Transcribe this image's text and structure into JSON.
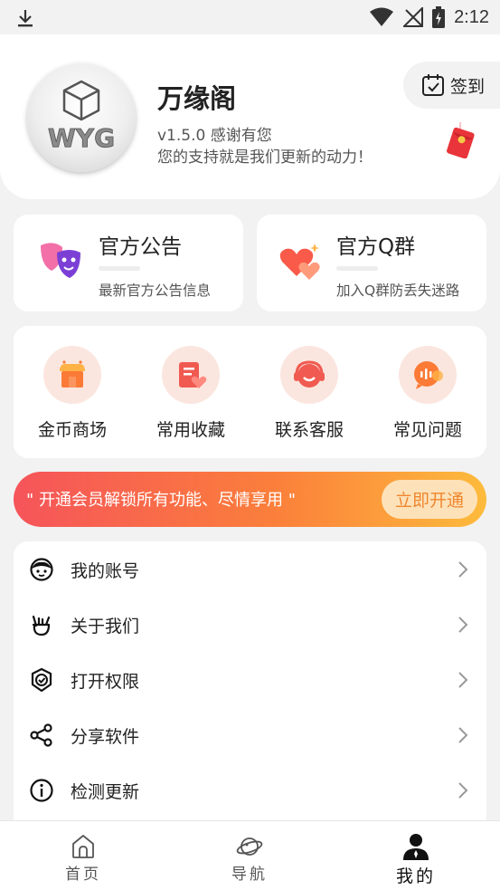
{
  "status_bar": {
    "time": "2:12",
    "icons": [
      "download-icon",
      "wifi-icon",
      "no-signal-icon",
      "battery-charging-icon"
    ]
  },
  "profile": {
    "app_name": "万缘阁",
    "logo_text": "WYG",
    "version_line": "v1.5.0  感谢有您",
    "slogan": "您的支持就是我们更新的动力！",
    "signin_label": "签到",
    "signin_icon": "calendar-check-icon"
  },
  "info_cards": [
    {
      "title": "官方公告",
      "subtitle": "最新官方公告信息",
      "icon": "masks-icon"
    },
    {
      "title": "官方Q群",
      "subtitle": "加入Q群防丢失迷路",
      "icon": "hearts-icon"
    }
  ],
  "quick_menu": [
    {
      "label": "金币商场",
      "icon": "store-icon"
    },
    {
      "label": "常用收藏",
      "icon": "favorite-note-icon"
    },
    {
      "label": "联系客服",
      "icon": "headset-icon"
    },
    {
      "label": "常见问题",
      "icon": "chat-bubble-icon"
    }
  ],
  "vip_banner": {
    "text": "\" 开通会员解锁所有功能、尽情享用 \"",
    "button_label": "立即开通"
  },
  "settings_list": [
    {
      "label": "我的账号",
      "icon": "face-icon"
    },
    {
      "label": "关于我们",
      "icon": "hand-icon"
    },
    {
      "label": "打开权限",
      "icon": "shield-check-icon"
    },
    {
      "label": "分享软件",
      "icon": "share-icon"
    },
    {
      "label": "检测更新",
      "icon": "info-icon"
    }
  ],
  "bottom_nav": [
    {
      "label": "首页",
      "icon": "home-icon",
      "active": false
    },
    {
      "label": "导航",
      "icon": "planet-icon",
      "active": false
    },
    {
      "label": "我的",
      "icon": "person-icon",
      "active": true
    }
  ],
  "colors": {
    "background": "#f2f2f2",
    "card": "#ffffff",
    "vip_gradient_start": "#f6545a",
    "vip_gradient_end": "#fdbb3c",
    "vip_button_text": "#f0862e",
    "grid_icon_bg": "#fbe6df"
  }
}
